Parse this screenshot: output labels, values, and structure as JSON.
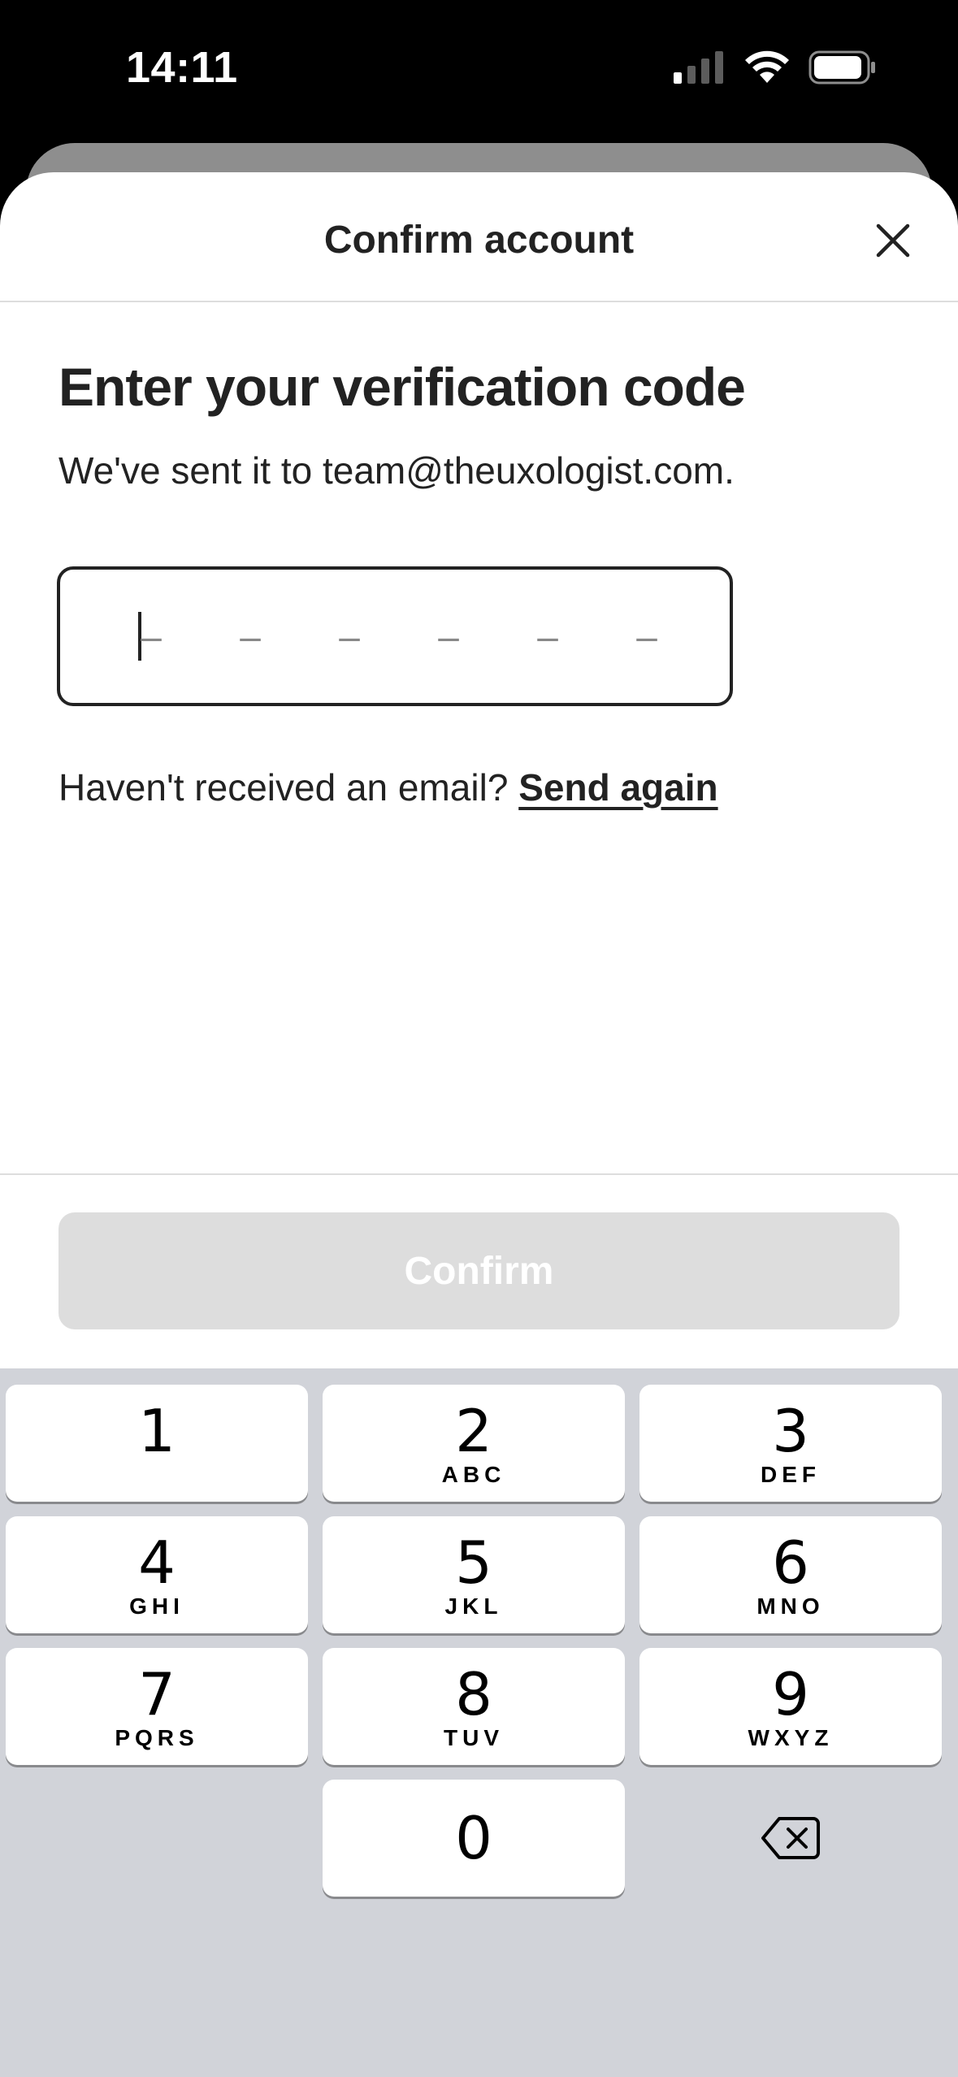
{
  "status_bar": {
    "time": "14:11"
  },
  "sheet": {
    "title": "Confirm account",
    "heading": "Enter your verification code",
    "subtext": "We've sent it to team@theuxologist.com.",
    "code_placeholder": [
      "–",
      "–",
      "–",
      "–",
      "–",
      "–"
    ],
    "resend_prompt": "Haven't received an email? ",
    "resend_link": "Send again",
    "confirm_label": "Confirm"
  },
  "keypad": {
    "keys": [
      {
        "digit": "1",
        "letters": ""
      },
      {
        "digit": "2",
        "letters": "ABC"
      },
      {
        "digit": "3",
        "letters": "DEF"
      },
      {
        "digit": "4",
        "letters": "GHI"
      },
      {
        "digit": "5",
        "letters": "JKL"
      },
      {
        "digit": "6",
        "letters": "MNO"
      },
      {
        "digit": "7",
        "letters": "PQRS"
      },
      {
        "digit": "8",
        "letters": "TUV"
      },
      {
        "digit": "9",
        "letters": "WXYZ"
      },
      {
        "digit": "0",
        "letters": ""
      }
    ]
  },
  "colors": {
    "text": "#222222",
    "disabled_button": "#dddddd",
    "keyboard_bg": "#d1d3d9"
  }
}
